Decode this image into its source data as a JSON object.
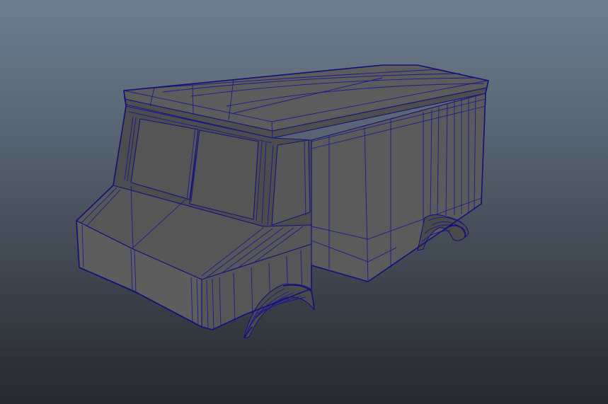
{
  "viewport": {
    "background_top": "#6d7e90",
    "background_bottom": "#26292d",
    "shading_color": "#5a5a5a",
    "wireframe_color": "#1d1a8c"
  },
  "model": {
    "object": "truck-body-mesh",
    "display_mode": "wireframe-on-shaded"
  }
}
